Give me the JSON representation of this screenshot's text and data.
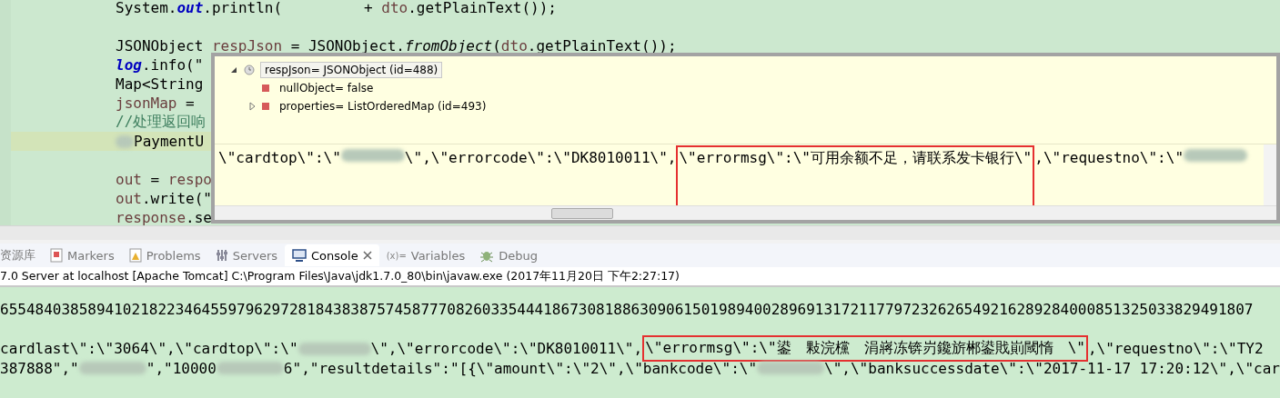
{
  "editor": {
    "lines": [
      {
        "highlighted": false,
        "tokens": [
          {
            "kind": "plain",
            "text": "System."
          },
          {
            "kind": "field",
            "text": "out"
          },
          {
            "kind": "plain",
            "text": ".println("
          },
          {
            "kind": "gap"
          },
          {
            "kind": "plain",
            "text": "+ "
          },
          {
            "kind": "var",
            "text": "dto"
          },
          {
            "kind": "plain",
            "text": ".getPlainText());"
          }
        ]
      },
      {
        "highlighted": false
      },
      {
        "highlighted": false,
        "tokens": [
          {
            "kind": "plain",
            "text": "JSONObject "
          },
          {
            "kind": "var",
            "text": "respJson"
          },
          {
            "kind": "plain",
            "text": " = JSONObject."
          },
          {
            "kind": "italic",
            "text": "fromObject"
          },
          {
            "kind": "plain",
            "text": "("
          },
          {
            "kind": "var",
            "text": "dto"
          },
          {
            "kind": "plain",
            "text": ".getPlainText());"
          }
        ]
      },
      {
        "highlighted": false,
        "tokens": [
          {
            "kind": "field",
            "text": "log"
          },
          {
            "kind": "plain",
            "text": ".info(\""
          }
        ]
      },
      {
        "highlighted": false,
        "tokens": [
          {
            "kind": "plain",
            "text": "Map<String"
          }
        ]
      },
      {
        "highlighted": false,
        "tokens": [
          {
            "kind": "var",
            "text": "jsonMap"
          },
          {
            "kind": "plain",
            "text": " = "
          }
        ]
      },
      {
        "highlighted": false,
        "tokens": [
          {
            "kind": "comment",
            "text": "//处理返回响"
          }
        ]
      },
      {
        "highlighted": true,
        "tokens": [
          {
            "kind": "blur"
          },
          {
            "kind": "plain",
            "text": "PaymentU"
          }
        ]
      },
      {
        "highlighted": false
      },
      {
        "highlighted": false,
        "tokens": [
          {
            "kind": "var",
            "text": "out"
          },
          {
            "kind": "plain",
            "text": " = "
          },
          {
            "kind": "var",
            "text": "respo"
          }
        ]
      },
      {
        "highlighted": false,
        "tokens": [
          {
            "kind": "var",
            "text": "out"
          },
          {
            "kind": "plain",
            "text": ".write(\""
          }
        ]
      },
      {
        "highlighted": false,
        "tokens": [
          {
            "kind": "var",
            "text": "response"
          },
          {
            "kind": "plain",
            "text": ".se"
          }
        ]
      }
    ]
  },
  "inspector": {
    "tree": [
      {
        "label": "respJson= JSONObject  (id=488)",
        "kind": "object",
        "selected": true,
        "expanded": true,
        "children": [
          {
            "label": "nullObject= false",
            "kind": "field",
            "selected": false
          },
          {
            "label": "properties= ListOrderedMap  (id=493)",
            "kind": "field",
            "selected": false,
            "expanded": false
          }
        ]
      }
    ],
    "detail": [
      {
        "kind": "text",
        "text": "\\\"cardtop\\\":\\\""
      },
      {
        "kind": "blur"
      },
      {
        "kind": "text",
        "text": "\\\",\\\"errorcode\\\":\\\"DK8010011\\\","
      },
      {
        "kind": "boxed",
        "text": "\\\"errormsg\\\":\\\"可用余额不足，请联系发卡银行\\\""
      },
      {
        "kind": "text",
        "text": ",\\\"requestno\\\":\\\""
      },
      {
        "kind": "blur"
      }
    ]
  },
  "panel": {
    "tabs": [
      {
        "label": "资源库",
        "selected": false
      },
      {
        "label": "Markers",
        "selected": false
      },
      {
        "label": "Problems",
        "selected": false
      },
      {
        "label": "Servers",
        "selected": false
      },
      {
        "label": "Console",
        "selected": true
      },
      {
        "label": "Variables",
        "glyph": "(x)=",
        "selected": false
      },
      {
        "label": "Debug",
        "selected": false
      }
    ],
    "process": "7.0 Server at localhost [Apache Tomcat] C:\\Program Files\\Java\\jdk1.7.0_80\\bin\\javaw.exe (2017年11月20日 下午2:27:17)",
    "console_lines": [
      [
        {
          "kind": "text",
          "text": "65548403858941021822346455979629728184383875745877708260335444186730818863090615019894002896913172117797232626549216289284000851325033829491807"
        }
      ],
      [
        {
          "kind": "text",
          "text": "cardlast\\\":\\\"3064\\\",\\\"cardtop\\\":\\\""
        },
        {
          "kind": "blur"
        },
        {
          "kind": "text",
          "text": "\\\",\\\"errorcode\\\":\\\"DK8010011\\\","
        },
        {
          "kind": "boxed",
          "text": "\\\"errormsg\\\":\\\"鍙　敤浣欓　涓嶈冻锛岃鑱旂郴鍙戝崱閾惰　\\\""
        },
        {
          "kind": "text",
          "text": ",\\\"requestno\\\":\\\"TY2"
        }
      ],
      [
        {
          "kind": "text",
          "text": "387888\",\""
        },
        {
          "kind": "blur"
        },
        {
          "kind": "text",
          "text": "\",\"10000"
        },
        {
          "kind": "blur"
        },
        {
          "kind": "text",
          "text": "6\",\"resultdetails\":\"[{\\\"amount\\\":\\\"2\\\",\\\"bankcode\\\":\\\""
        },
        {
          "kind": "blur"
        },
        {
          "kind": "text",
          "text": "\\\",\\\"banksuccessdate\\\":\\\"2017-11-17 17:20:12\\\",\\\"car"
        }
      ]
    ]
  }
}
